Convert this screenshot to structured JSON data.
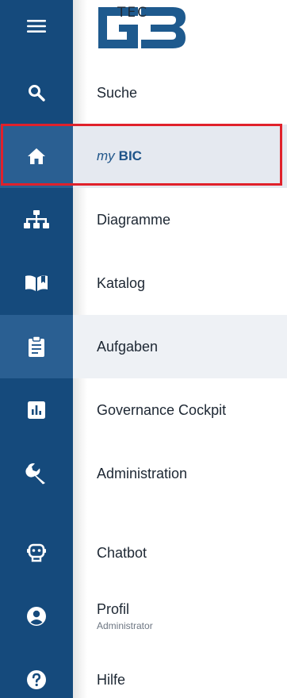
{
  "brand": {
    "logo_text": "TEC"
  },
  "colors": {
    "rail": "#154a7c",
    "rail_active": "#2a5f92",
    "active_label_bg": "#e5e9f0",
    "highlight_border": "#e0212b",
    "accent_text": "#1e5489"
  },
  "nav": {
    "menu_icon": "hamburger-menu-icon",
    "items": [
      {
        "id": "suche",
        "label": "Suche",
        "icon": "search-icon"
      },
      {
        "id": "mybic",
        "label_prefix": "my",
        "label_main": "BIC",
        "icon": "home-icon",
        "active": true,
        "highlighted": true
      },
      {
        "id": "diagramme",
        "label": "Diagramme",
        "icon": "sitemap-icon"
      },
      {
        "id": "katalog",
        "label": "Katalog",
        "icon": "book-icon"
      },
      {
        "id": "aufgaben",
        "label": "Aufgaben",
        "icon": "clipboard-icon",
        "active": true
      },
      {
        "id": "governance",
        "label": "Governance Cockpit",
        "icon": "chart-icon"
      },
      {
        "id": "administration",
        "label": "Administration",
        "icon": "wrench-icon"
      },
      {
        "id": "chatbot",
        "label": "Chatbot",
        "icon": "robot-icon"
      },
      {
        "id": "profil",
        "label": "Profil",
        "sublabel": "Administrator",
        "icon": "user-circle-icon"
      },
      {
        "id": "hilfe",
        "label": "Hilfe",
        "icon": "help-icon"
      }
    ]
  }
}
